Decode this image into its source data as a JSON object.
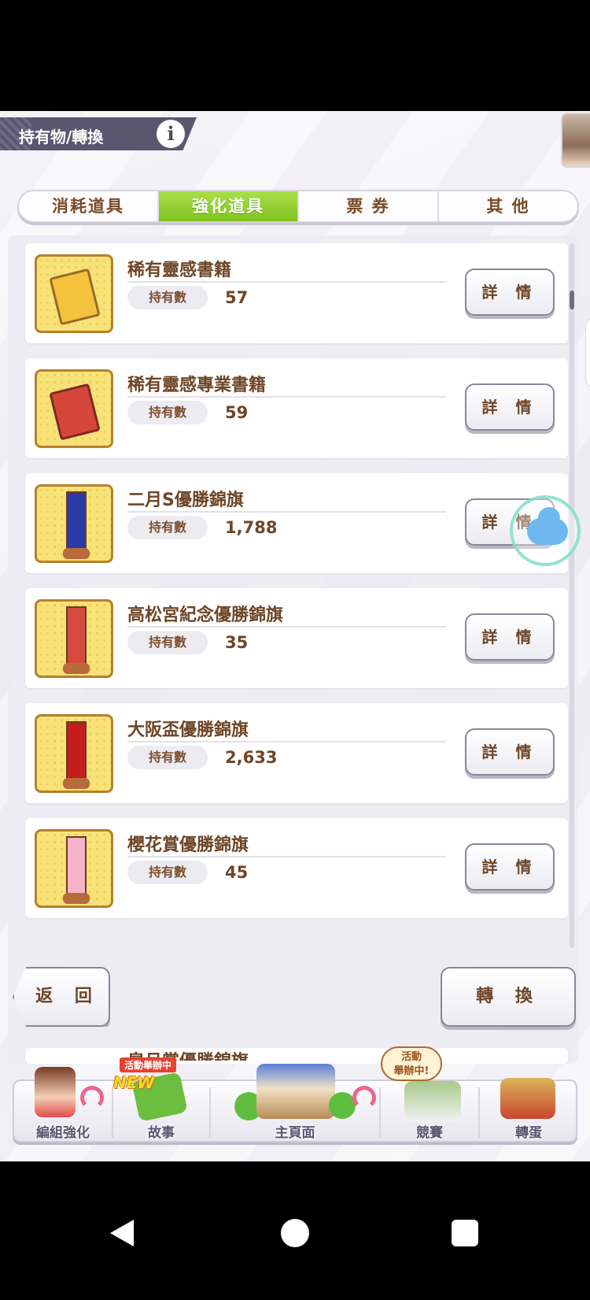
{
  "header": {
    "title": "持有物/轉換",
    "info_label": "i"
  },
  "tabs": [
    {
      "label": "消耗道具",
      "active": false
    },
    {
      "label": "強化道具",
      "active": true
    },
    {
      "label": "票 券",
      "active": false
    },
    {
      "label": "其 他",
      "active": false
    }
  ],
  "items": [
    {
      "name": "稀有靈感書籍",
      "qty_label": "持有數",
      "qty": "57",
      "detail_label": "詳 情",
      "icon": "yellow-book-icon"
    },
    {
      "name": "稀有靈感專業書籍",
      "qty_label": "持有數",
      "qty": "59",
      "detail_label": "詳 情",
      "icon": "red-book-icon"
    },
    {
      "name": "二月S優勝錦旗",
      "qty_label": "持有數",
      "qty": "1,788",
      "detail_label": "詳 情",
      "icon": "blue-pennant-icon"
    },
    {
      "name": "高松宮紀念優勝錦旗",
      "qty_label": "持有數",
      "qty": "35",
      "detail_label": "詳 情",
      "icon": "red-pennant-icon"
    },
    {
      "name": "大阪盃優勝錦旗",
      "qty_label": "持有數",
      "qty": "2,633",
      "detail_label": "詳 情",
      "icon": "darkred-pennant-icon"
    },
    {
      "name": "櫻花賞優勝錦旗",
      "qty_label": "持有數",
      "qty": "45",
      "detail_label": "詳 情",
      "icon": "pink-pennant-icon"
    }
  ],
  "partial_item": {
    "name": "皐月賞優勝錦旗"
  },
  "footer": {
    "back_label": "返 回",
    "convert_label": "轉 換"
  },
  "bottom_nav": [
    {
      "label": "編組強化",
      "icon": "character-icon"
    },
    {
      "label": "故事",
      "icon": "story-book-icon",
      "badge": "活動舉辦中",
      "new_badge": "NEW"
    },
    {
      "label": "主頁面",
      "icon": "building-icon"
    },
    {
      "label": "競賽",
      "icon": "race-gate-icon",
      "badge": "活動\n舉辦中!"
    },
    {
      "label": "轉蛋",
      "icon": "gacha-door-icon"
    }
  ],
  "colors": {
    "accent_green": "#8fd12a",
    "text_brown": "#6e4526",
    "header_bg": "#5b5670"
  }
}
